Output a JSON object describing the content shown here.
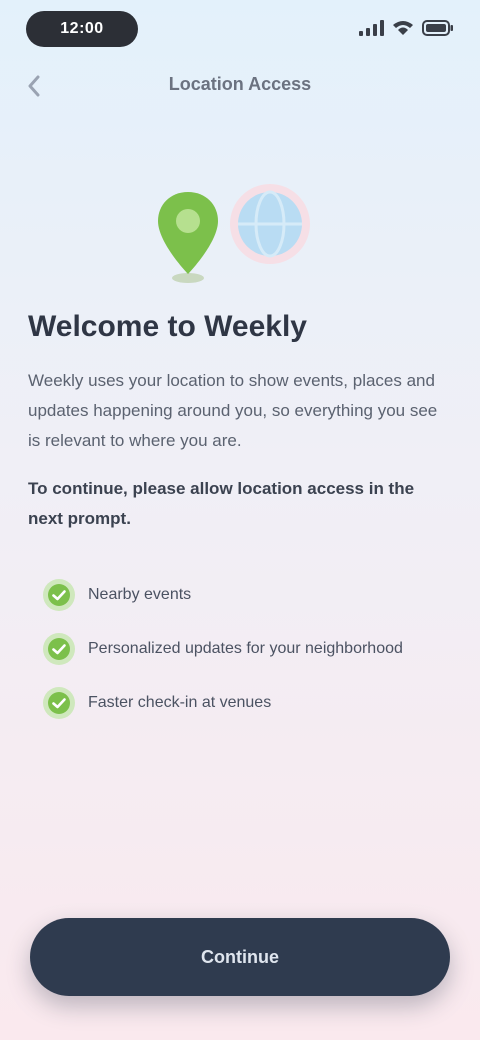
{
  "status_bar": {
    "time": "12:00"
  },
  "nav": {
    "title": "Location Access"
  },
  "content": {
    "title": "Welcome to Weekly",
    "intro": "Weekly uses your location to show events, places and updates happening around you, so everything you see is relevant to where you are.",
    "permission": "To continue, please allow location access in the next prompt.",
    "benefits": [
      "Nearby events",
      "Personalized updates for your neighborhood",
      "Faster check-in at venues"
    ]
  },
  "footer": {
    "continue_label": "Continue"
  },
  "colors": {
    "button_bg": "#2f3b4f",
    "accent_green": "#7cc04b",
    "globe_blue": "#b9dcf3"
  }
}
